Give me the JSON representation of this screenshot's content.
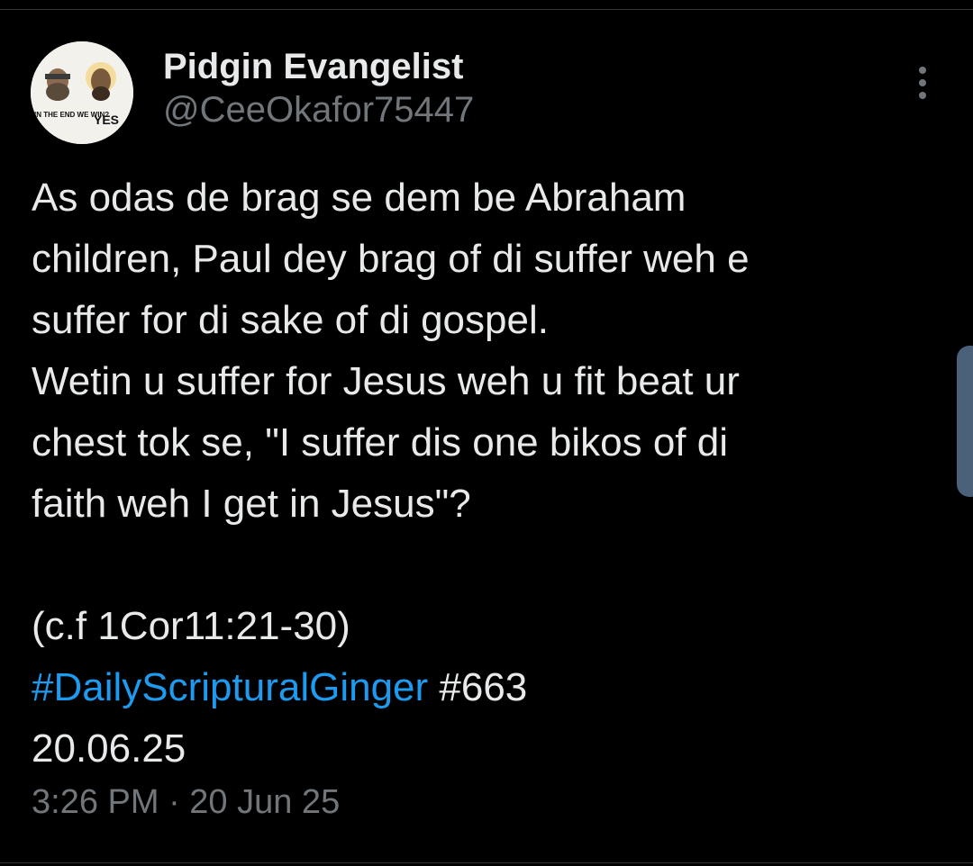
{
  "tweet": {
    "author": {
      "display_name": "Pidgin Evangelist",
      "handle": "@CeeOkafor75447",
      "avatar_text_left": "IN THE END WE WIN?",
      "avatar_text_right": "YES"
    },
    "body_lines": [
      "As odas de brag se dem be Abraham",
      "children, Paul dey brag of di suffer weh e",
      "suffer for di sake of di gospel.",
      "Wetin u suffer for Jesus weh u fit beat ur",
      "chest tok se, \"I suffer dis one bikos of di",
      "faith weh I get in Jesus\"?"
    ],
    "reference": "(c.f 1Cor11:21-30)",
    "hashtag": "#DailyScripturalGinger",
    "number_tag": " #663",
    "date_line": "20.06.25",
    "timestamp": "3:26 PM · 20 Jun 25"
  },
  "colors": {
    "background": "#000000",
    "text": "#e7e9ea",
    "muted": "#71767b",
    "link": "#1d9bf0"
  },
  "icons": {
    "more": "more-vertical-icon"
  }
}
